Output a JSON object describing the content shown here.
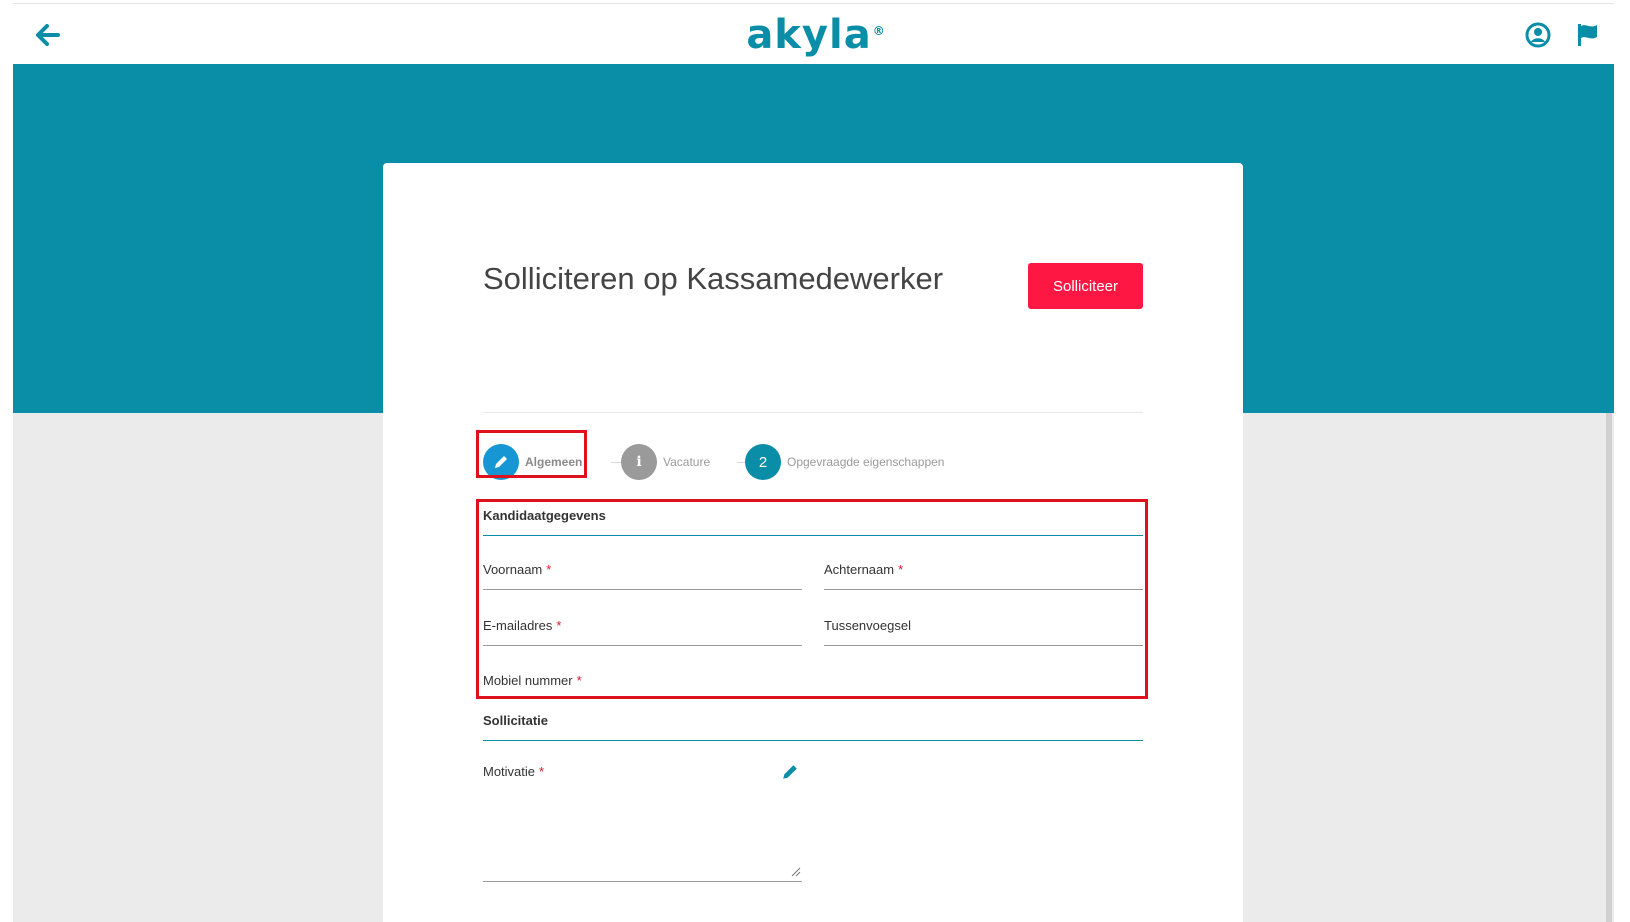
{
  "brand": {
    "logo_text": "akyla",
    "logo_mark": "®"
  },
  "colors": {
    "primary": "#0a8ea8",
    "accent_red": "#ff1744",
    "step_active": "#1696d2",
    "step_inactive": "#9a9a9a",
    "step_current": "#0a8ea8",
    "highlight": "#e0111e"
  },
  "header": {
    "back_icon": "arrow-left-icon",
    "account_icon": "user-circle-icon",
    "language_icon": "flag-icon"
  },
  "page": {
    "title": "Solliciteren op Kassamedewerker",
    "apply_button": "Solliciteer"
  },
  "stepper": {
    "steps": [
      {
        "label": "Algemeen",
        "icon": "pencil-icon"
      },
      {
        "label": "Vacature",
        "icon": "info-icon"
      },
      {
        "label": "Opgevraagde eigenschappen",
        "number": "2"
      }
    ]
  },
  "form": {
    "sections": [
      {
        "title": "Kandidaatgegevens",
        "fields": [
          {
            "label": "Voornaam",
            "required": "*"
          },
          {
            "label": "Achternaam",
            "required": "*"
          },
          {
            "label": "E-mailadres",
            "required": "*"
          },
          {
            "label": "Tussenvoegsel",
            "required": ""
          },
          {
            "label": "Mobiel nummer",
            "required": "*"
          }
        ]
      },
      {
        "title": "Sollicitatie",
        "fields": [
          {
            "label": "Motivatie",
            "required": "*",
            "icon": "pencil-icon"
          }
        ]
      }
    ]
  }
}
